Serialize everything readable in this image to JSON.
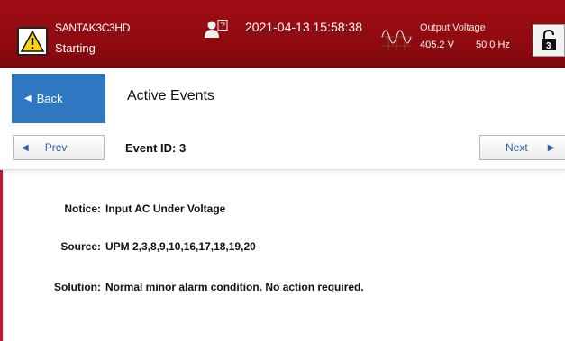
{
  "header": {
    "device_name": "SANTAK3C3HD",
    "device_state": "Starting",
    "user_badge": "?",
    "datetime": "2021-04-13 15:58:38",
    "output_label": "Output Voltage",
    "output_voltage": "405.2 V",
    "output_frequency": "50.0 Hz",
    "lock_digit": "3"
  },
  "title_row": {
    "back_label": "Back",
    "page_title": "Active Events"
  },
  "nav": {
    "prev_label": "Prev",
    "event_id_label": "Event ID: 3",
    "next_label": "Next"
  },
  "details": {
    "notice_label": "Notice:",
    "notice_value": "Input AC Under Voltage",
    "source_label": "Source:",
    "source_value": "UPM 2,3,8,9,10,16,17,18,19,20",
    "solution_label": "Solution:",
    "solution_value": "Normal minor alarm condition. No action required."
  },
  "colors": {
    "header_red": "#8c0a0f",
    "back_blue": "#2f77c0",
    "link_blue": "#2f62a8",
    "warning_yellow": "#ffd400"
  },
  "icons": [
    "warning-icon",
    "user-icon",
    "sine-wave-icon",
    "lock-icon",
    "left-arrow-icon",
    "right-arrow-icon"
  ]
}
